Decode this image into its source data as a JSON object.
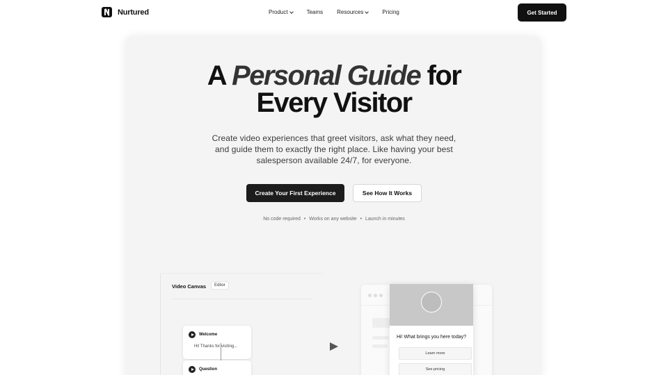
{
  "brand": {
    "name": "Nurtured",
    "logo_icon": "n-logo-icon"
  },
  "nav": {
    "items": [
      {
        "label": "Product",
        "has_dropdown": true
      },
      {
        "label": "Teams",
        "has_dropdown": false
      },
      {
        "label": "Resources",
        "has_dropdown": true
      },
      {
        "label": "Pricing",
        "has_dropdown": false
      }
    ],
    "cta_label": "Get Started"
  },
  "hero": {
    "headline_a": "A",
    "headline_em": "Personal Guide",
    "headline_b": "for",
    "headline_line2": "Every Visitor",
    "subtitle": "Create video experiences that greet visitors, ask what they need, and guide them to exactly the right place. Like having your best salesperson available 24/7, for everyone.",
    "primary_cta": "Create Your First Experience",
    "secondary_cta": "See How It Works",
    "bullets": [
      "No code required",
      "Works on any website",
      "Launch in minutes"
    ],
    "bullet_separator": "•"
  },
  "canvas": {
    "title": "Video Canvas",
    "tag": "Editor",
    "nodes": [
      {
        "title": "Welcome",
        "body": "Hi! Thanks for visiting..."
      },
      {
        "title": "Question",
        "body": ""
      }
    ]
  },
  "widget": {
    "question": "Hi! What brings you here today?",
    "options": [
      "Learn more",
      "See pricing"
    ]
  },
  "colors": {
    "primary": "#111111",
    "card_bg": "#f4f4f4",
    "accent_text": "#333333"
  }
}
